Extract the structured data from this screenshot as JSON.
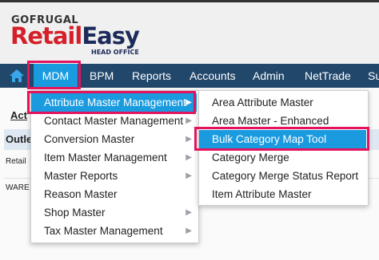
{
  "brand": {
    "top": "GOFRUGAL",
    "name_red": "Retail",
    "name_blue": "Easy",
    "sub": "HEAD OFFICE"
  },
  "nav": {
    "home_icon": "home-icon",
    "items": [
      "MDM",
      "BPM",
      "Reports",
      "Accounts",
      "Admin",
      "NetTrade",
      "Su"
    ]
  },
  "background": {
    "header_cell": "Act",
    "row_label": "Outle",
    "row1": "Retail",
    "row2": "WARE"
  },
  "mdm_menu": [
    "Attribute Master Management",
    "Contact Master Management",
    "Conversion Master",
    "Item Master Management",
    "Master Reports",
    "Reason Master",
    "Shop Master",
    "Tax Master Management"
  ],
  "attribute_submenu": [
    "Area Attribute Master",
    "Area Master - Enhanced",
    "Bulk Category Map Tool",
    "Category Merge",
    "Category Merge Status Report",
    "Item Attribute Master"
  ],
  "colors": {
    "navbar": "#21476b",
    "highlight": "#1a9be0",
    "annotation": "#e3135e"
  }
}
